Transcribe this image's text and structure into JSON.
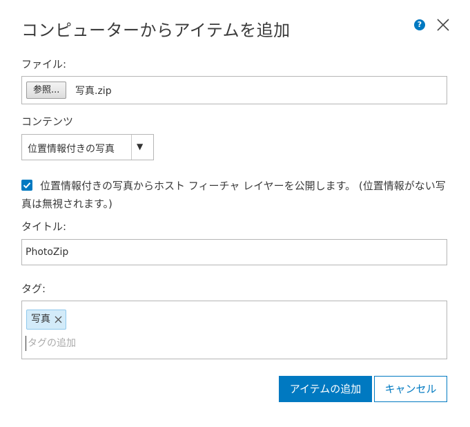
{
  "dialog": {
    "title": "コンピューターからアイテムを追加",
    "help_glyph": "?",
    "help_icon": "help-icon",
    "close_icon": "close-icon"
  },
  "file": {
    "label": "ファイル:",
    "browse_label": "参照...",
    "selected_file": "写真.zip"
  },
  "contents": {
    "label": "コンテンツ",
    "selected_value": "位置情報付きの写真",
    "arrow": "▼"
  },
  "publish_option": {
    "checked": true,
    "text": "位置情報付きの写真からホスト フィーチャ レイヤーを公開します。 (位置情報がない写真は無視されます。)"
  },
  "title_field": {
    "label": "タイトル:",
    "value": "PhotoZip"
  },
  "tags": {
    "label": "タグ:",
    "items": [
      "写真"
    ],
    "placeholder": "タグの追加"
  },
  "actions": {
    "add_item_label": "アイテムの追加",
    "cancel_label": "キャンセル"
  },
  "colors": {
    "accent": "#0079c1",
    "tag_bg": "#d3ebf9",
    "border": "#b5b5b5"
  }
}
